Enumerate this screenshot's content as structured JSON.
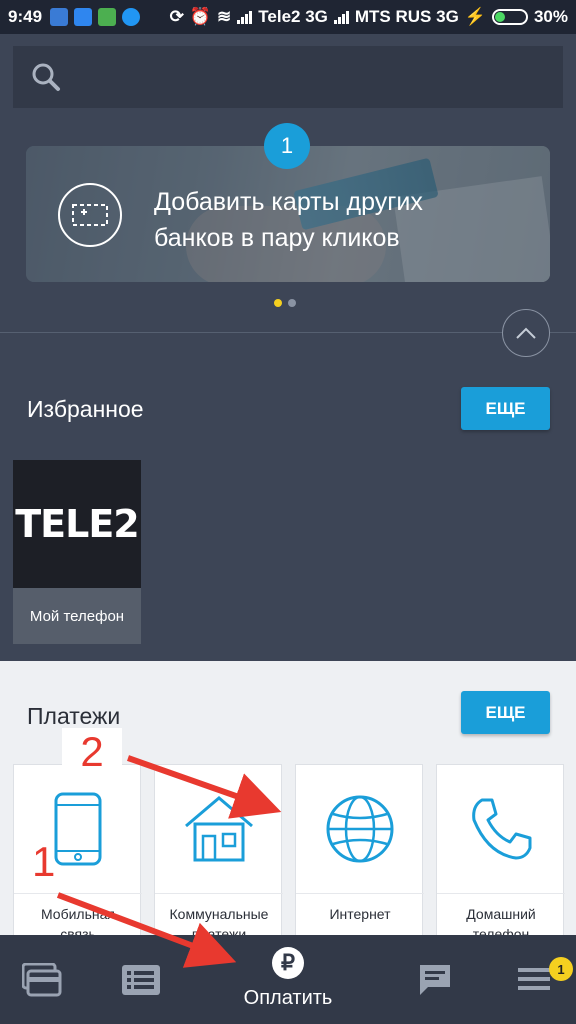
{
  "status_bar": {
    "time": "9:49",
    "carrier1": "Tele2 3G",
    "carrier2": "MTS RUS 3G",
    "battery": "30%",
    "battery_level": 0.3
  },
  "search": {
    "icon": "search-icon"
  },
  "promo": {
    "badge": "1",
    "text_line1": "Добавить карты других",
    "text_line2": "банков в пару кликов",
    "active_dot_color": "#f5d020",
    "dot_color": "#8a93a3"
  },
  "favorites": {
    "title": "Избранное",
    "more_label": "ЕЩЕ",
    "items": [
      {
        "logo_text": "TELE2",
        "label": "Мой телефон"
      }
    ]
  },
  "payments": {
    "title": "Платежи",
    "more_label": "ЕЩЕ",
    "items": [
      {
        "label_l1": "Мобильная",
        "label_l2": "связь",
        "icon": "mobile-phone-icon"
      },
      {
        "label_l1": "Коммунальные",
        "label_l2": "платежи",
        "icon": "house-icon"
      },
      {
        "label_l1": "Интернет",
        "label_l2": "",
        "icon": "globe-icon"
      },
      {
        "label_l1": "Домашний",
        "label_l2": "телефон",
        "icon": "handset-icon"
      }
    ]
  },
  "bottom_nav": {
    "pay_label": "Оплатить",
    "pay_symbol": "₽",
    "menu_badge": "1"
  },
  "annotations": {
    "arrow1": "1",
    "arrow2": "2",
    "color": "#e8392f"
  },
  "colors": {
    "accent": "#1a9ed9",
    "background": "#3d4556",
    "statusbar": "#1f2533"
  }
}
